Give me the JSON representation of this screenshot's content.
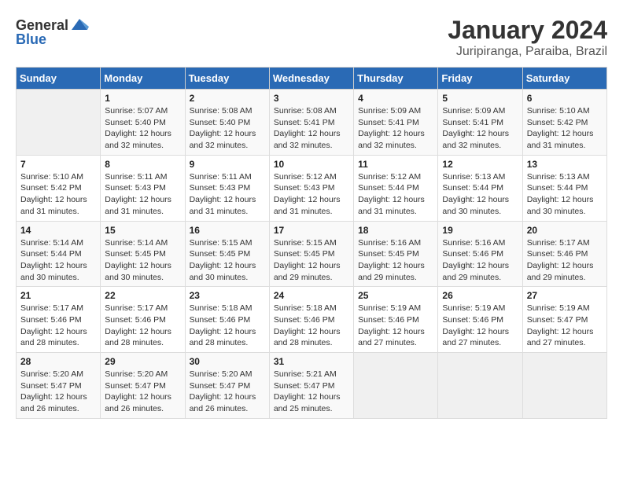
{
  "logo": {
    "text_general": "General",
    "text_blue": "Blue"
  },
  "title": "January 2024",
  "subtitle": "Juripiranga, Paraiba, Brazil",
  "days_of_week": [
    "Sunday",
    "Monday",
    "Tuesday",
    "Wednesday",
    "Thursday",
    "Friday",
    "Saturday"
  ],
  "weeks": [
    [
      {
        "num": "",
        "sunrise": "",
        "sunset": "",
        "daylight": ""
      },
      {
        "num": "1",
        "sunrise": "Sunrise: 5:07 AM",
        "sunset": "Sunset: 5:40 PM",
        "daylight": "Daylight: 12 hours and 32 minutes."
      },
      {
        "num": "2",
        "sunrise": "Sunrise: 5:08 AM",
        "sunset": "Sunset: 5:40 PM",
        "daylight": "Daylight: 12 hours and 32 minutes."
      },
      {
        "num": "3",
        "sunrise": "Sunrise: 5:08 AM",
        "sunset": "Sunset: 5:41 PM",
        "daylight": "Daylight: 12 hours and 32 minutes."
      },
      {
        "num": "4",
        "sunrise": "Sunrise: 5:09 AM",
        "sunset": "Sunset: 5:41 PM",
        "daylight": "Daylight: 12 hours and 32 minutes."
      },
      {
        "num": "5",
        "sunrise": "Sunrise: 5:09 AM",
        "sunset": "Sunset: 5:41 PM",
        "daylight": "Daylight: 12 hours and 32 minutes."
      },
      {
        "num": "6",
        "sunrise": "Sunrise: 5:10 AM",
        "sunset": "Sunset: 5:42 PM",
        "daylight": "Daylight: 12 hours and 31 minutes."
      }
    ],
    [
      {
        "num": "7",
        "sunrise": "Sunrise: 5:10 AM",
        "sunset": "Sunset: 5:42 PM",
        "daylight": "Daylight: 12 hours and 31 minutes."
      },
      {
        "num": "8",
        "sunrise": "Sunrise: 5:11 AM",
        "sunset": "Sunset: 5:43 PM",
        "daylight": "Daylight: 12 hours and 31 minutes."
      },
      {
        "num": "9",
        "sunrise": "Sunrise: 5:11 AM",
        "sunset": "Sunset: 5:43 PM",
        "daylight": "Daylight: 12 hours and 31 minutes."
      },
      {
        "num": "10",
        "sunrise": "Sunrise: 5:12 AM",
        "sunset": "Sunset: 5:43 PM",
        "daylight": "Daylight: 12 hours and 31 minutes."
      },
      {
        "num": "11",
        "sunrise": "Sunrise: 5:12 AM",
        "sunset": "Sunset: 5:44 PM",
        "daylight": "Daylight: 12 hours and 31 minutes."
      },
      {
        "num": "12",
        "sunrise": "Sunrise: 5:13 AM",
        "sunset": "Sunset: 5:44 PM",
        "daylight": "Daylight: 12 hours and 30 minutes."
      },
      {
        "num": "13",
        "sunrise": "Sunrise: 5:13 AM",
        "sunset": "Sunset: 5:44 PM",
        "daylight": "Daylight: 12 hours and 30 minutes."
      }
    ],
    [
      {
        "num": "14",
        "sunrise": "Sunrise: 5:14 AM",
        "sunset": "Sunset: 5:44 PM",
        "daylight": "Daylight: 12 hours and 30 minutes."
      },
      {
        "num": "15",
        "sunrise": "Sunrise: 5:14 AM",
        "sunset": "Sunset: 5:45 PM",
        "daylight": "Daylight: 12 hours and 30 minutes."
      },
      {
        "num": "16",
        "sunrise": "Sunrise: 5:15 AM",
        "sunset": "Sunset: 5:45 PM",
        "daylight": "Daylight: 12 hours and 30 minutes."
      },
      {
        "num": "17",
        "sunrise": "Sunrise: 5:15 AM",
        "sunset": "Sunset: 5:45 PM",
        "daylight": "Daylight: 12 hours and 29 minutes."
      },
      {
        "num": "18",
        "sunrise": "Sunrise: 5:16 AM",
        "sunset": "Sunset: 5:45 PM",
        "daylight": "Daylight: 12 hours and 29 minutes."
      },
      {
        "num": "19",
        "sunrise": "Sunrise: 5:16 AM",
        "sunset": "Sunset: 5:46 PM",
        "daylight": "Daylight: 12 hours and 29 minutes."
      },
      {
        "num": "20",
        "sunrise": "Sunrise: 5:17 AM",
        "sunset": "Sunset: 5:46 PM",
        "daylight": "Daylight: 12 hours and 29 minutes."
      }
    ],
    [
      {
        "num": "21",
        "sunrise": "Sunrise: 5:17 AM",
        "sunset": "Sunset: 5:46 PM",
        "daylight": "Daylight: 12 hours and 28 minutes."
      },
      {
        "num": "22",
        "sunrise": "Sunrise: 5:17 AM",
        "sunset": "Sunset: 5:46 PM",
        "daylight": "Daylight: 12 hours and 28 minutes."
      },
      {
        "num": "23",
        "sunrise": "Sunrise: 5:18 AM",
        "sunset": "Sunset: 5:46 PM",
        "daylight": "Daylight: 12 hours and 28 minutes."
      },
      {
        "num": "24",
        "sunrise": "Sunrise: 5:18 AM",
        "sunset": "Sunset: 5:46 PM",
        "daylight": "Daylight: 12 hours and 28 minutes."
      },
      {
        "num": "25",
        "sunrise": "Sunrise: 5:19 AM",
        "sunset": "Sunset: 5:46 PM",
        "daylight": "Daylight: 12 hours and 27 minutes."
      },
      {
        "num": "26",
        "sunrise": "Sunrise: 5:19 AM",
        "sunset": "Sunset: 5:46 PM",
        "daylight": "Daylight: 12 hours and 27 minutes."
      },
      {
        "num": "27",
        "sunrise": "Sunrise: 5:19 AM",
        "sunset": "Sunset: 5:47 PM",
        "daylight": "Daylight: 12 hours and 27 minutes."
      }
    ],
    [
      {
        "num": "28",
        "sunrise": "Sunrise: 5:20 AM",
        "sunset": "Sunset: 5:47 PM",
        "daylight": "Daylight: 12 hours and 26 minutes."
      },
      {
        "num": "29",
        "sunrise": "Sunrise: 5:20 AM",
        "sunset": "Sunset: 5:47 PM",
        "daylight": "Daylight: 12 hours and 26 minutes."
      },
      {
        "num": "30",
        "sunrise": "Sunrise: 5:20 AM",
        "sunset": "Sunset: 5:47 PM",
        "daylight": "Daylight: 12 hours and 26 minutes."
      },
      {
        "num": "31",
        "sunrise": "Sunrise: 5:21 AM",
        "sunset": "Sunset: 5:47 PM",
        "daylight": "Daylight: 12 hours and 25 minutes."
      },
      {
        "num": "",
        "sunrise": "",
        "sunset": "",
        "daylight": ""
      },
      {
        "num": "",
        "sunrise": "",
        "sunset": "",
        "daylight": ""
      },
      {
        "num": "",
        "sunrise": "",
        "sunset": "",
        "daylight": ""
      }
    ]
  ]
}
